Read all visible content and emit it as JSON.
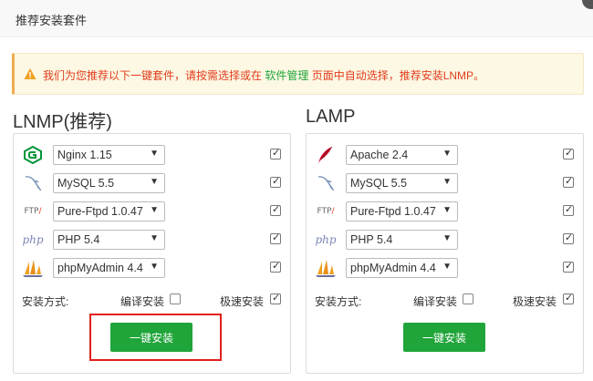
{
  "dialog": {
    "title": "推荐安装套件"
  },
  "notice": {
    "text_before": "我们为您推荐以下一键套件，请按需选择或在",
    "link": "软件管理",
    "text_after": "页面中自动选择，推荐安装LNMP。",
    "icon": "warning-icon"
  },
  "panels": [
    {
      "title": "LNMP(推荐)",
      "rows": [
        {
          "icon": "nginx-logo-icon",
          "selected": "Nginx 1.15",
          "checked": true
        },
        {
          "icon": "mysql-dolphin-icon",
          "selected": "MySQL 5.5",
          "checked": true
        },
        {
          "icon": "ftp-logo-icon",
          "selected": "Pure-Ftpd 1.0.47",
          "checked": true
        },
        {
          "icon": "php-logo-icon",
          "selected": "PHP 5.4",
          "checked": true
        },
        {
          "icon": "phpmyadmin-sailboat-icon",
          "selected": "phpMyAdmin 4.4",
          "checked": true
        }
      ],
      "method_label": "安装方式:",
      "compile_label": "编译安装",
      "compile_checked": false,
      "fast_label": "极速安装",
      "fast_checked": true,
      "button": "一键安装"
    },
    {
      "title": "LAMP",
      "rows": [
        {
          "icon": "apache-feather-icon",
          "selected": "Apache 2.4",
          "checked": true
        },
        {
          "icon": "mysql-dolphin-icon",
          "selected": "MySQL 5.5",
          "checked": true
        },
        {
          "icon": "ftp-logo-icon",
          "selected": "Pure-Ftpd 1.0.47",
          "checked": true
        },
        {
          "icon": "php-logo-icon",
          "selected": "PHP 5.4",
          "checked": true
        },
        {
          "icon": "phpmyadmin-sailboat-icon",
          "selected": "phpMyAdmin 4.4",
          "checked": true
        }
      ],
      "method_label": "安装方式:",
      "compile_label": "编译安装",
      "compile_checked": false,
      "fast_label": "极速安装",
      "fast_checked": true,
      "button": "一键安装"
    }
  ],
  "colors": {
    "accent": "#20a53a",
    "warning": "#e23c1c",
    "highlight": "#e0201b"
  }
}
